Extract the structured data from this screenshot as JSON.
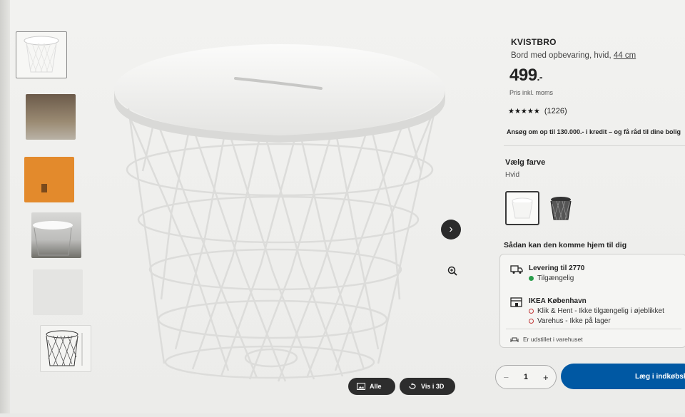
{
  "gallery": {
    "thumbnails": [
      "product-white",
      "room-scene",
      "orange-background",
      "table-in-use",
      "close-up",
      "dimensions"
    ],
    "next_icon": "chevron-right-icon",
    "zoom_icon": "zoom-icon",
    "all_label": "Alle",
    "view3d_label": "Vis i 3D"
  },
  "product": {
    "brand": "KVISTBRO",
    "description": "Bord med opbevaring, hvid,",
    "size": "44 cm",
    "price": "499",
    "price_suffix": ".-",
    "vat_note": "Pris inkl. moms",
    "stars": "★★★★★",
    "review_count": "(1226)",
    "credit_note": "Ansøg om op til 130.000.- i kredit – og få råd til dine bolig"
  },
  "color": {
    "title": "Vælg farve",
    "selected": "Hvid",
    "options": [
      "white",
      "black"
    ]
  },
  "delivery": {
    "title": "Sådan kan den komme hjem til dig",
    "shipping_label": "Levering til 2770",
    "shipping_status": "Tilgængelig",
    "store_label": "IKEA København",
    "click_collect": "Klik & Hent - Ikke tilgængelig i øjeblikket",
    "warehouse": "Varehus - Ikke på lager",
    "display_note": "Er udstillet i varehuset"
  },
  "cart": {
    "quantity": "1",
    "minus": "−",
    "plus": "+",
    "add_label": "Læg i indkøbskurv"
  },
  "colors": {
    "accent": "#0058a3",
    "available": "#2a9d4b",
    "unavailable": "#c23b3b"
  }
}
